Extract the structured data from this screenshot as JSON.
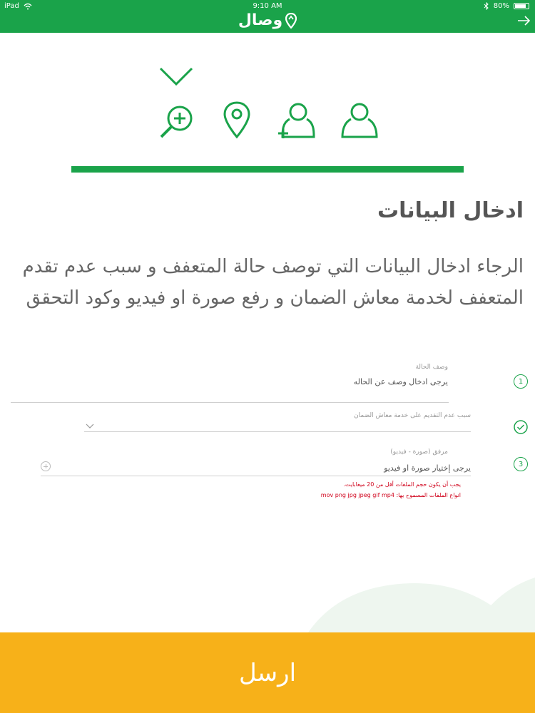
{
  "status": {
    "device": "iPad",
    "time": "9:10 AM",
    "battery": "80%"
  },
  "header": {
    "brand": "وصال"
  },
  "page": {
    "heading": "ادخال البيانات",
    "description": "الرجاء ادخال البيانات التي توصف حالة المتعفف و سبب عدم تقدم المتعفف لخدمة معاش الضمان و رفع صورة او فيديو وكود التحقق"
  },
  "form": {
    "field1": {
      "number": "1",
      "label": "وصف الحالة",
      "placeholder": "يرجى ادخال وصف عن الحاله"
    },
    "field2": {
      "label": "سبب عدم التقديم على خدمة معاش الضمان"
    },
    "field3": {
      "number": "3",
      "label": "مرفق (صورة - فيديو)",
      "placeholder": "يرجى إختيار صورة او فيديو",
      "note_size": "يجب أن يكون حجم الملفات أقل من 20 ميغابايت.",
      "note_types": "انواع الملفات المسموح بها: mov png jpg jpeg gif mp4"
    }
  },
  "actions": {
    "submit": "ارسل"
  },
  "colors": {
    "primary": "#1aa34a",
    "accent": "#f7b119",
    "error": "#d0021b"
  },
  "icons": [
    "wifi-icon",
    "bluetooth-icon",
    "battery-icon",
    "back-arrow-icon",
    "chevron-down-icon",
    "search-plus-icon",
    "location-pin-icon",
    "user-add-icon",
    "user-icon",
    "check-icon",
    "plus-circle-icon"
  ]
}
